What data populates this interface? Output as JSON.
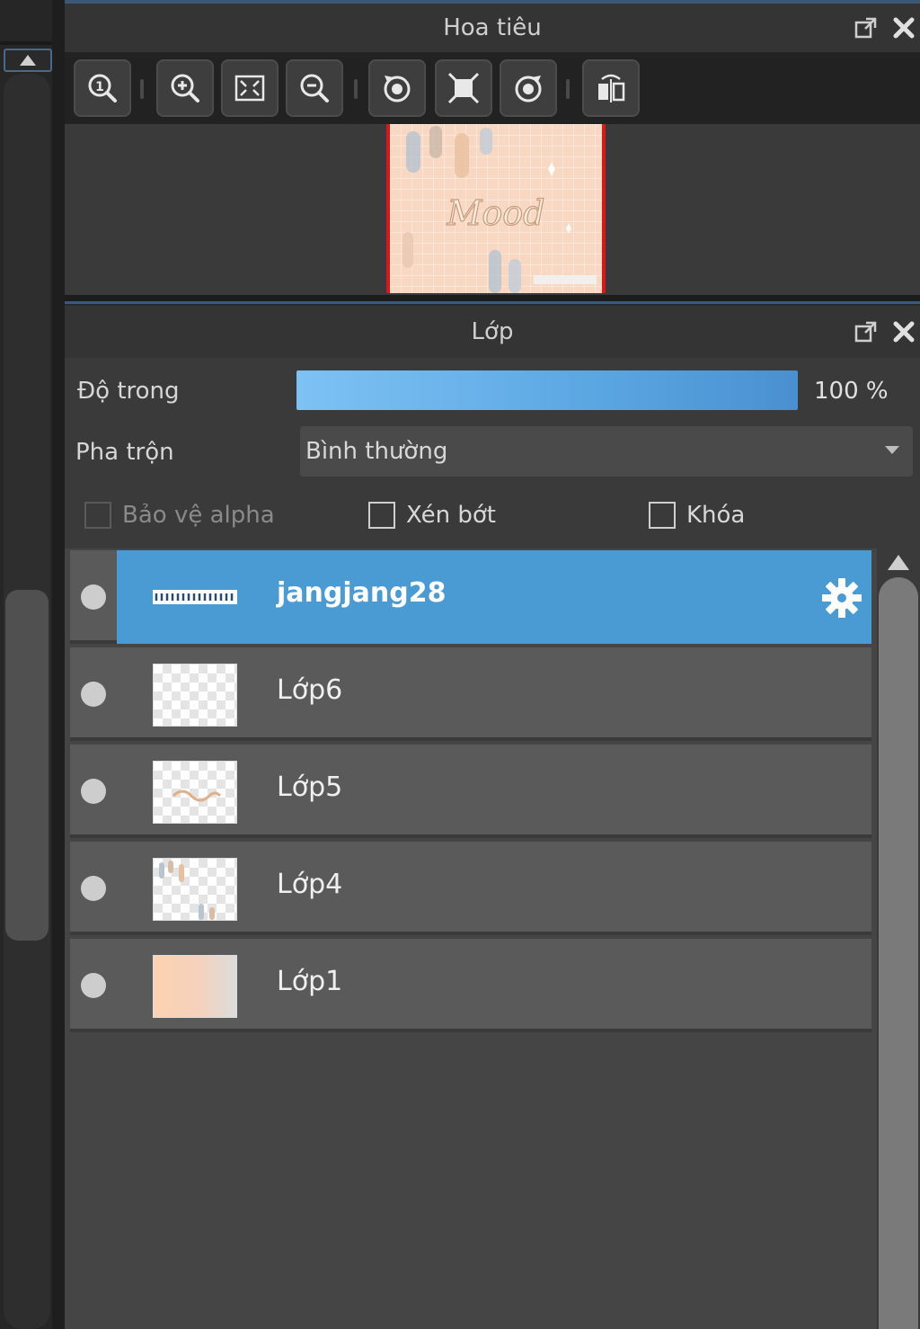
{
  "navigator": {
    "title": "Hoa tiêu",
    "toolbar": [
      {
        "icon": "zoom-actual-icon"
      },
      {
        "icon": "zoom-in-icon"
      },
      {
        "icon": "fit-screen-icon"
      },
      {
        "icon": "zoom-out-icon"
      },
      {
        "icon": "rotate-left-icon"
      },
      {
        "icon": "reset-view-icon"
      },
      {
        "icon": "rotate-right-icon"
      },
      {
        "icon": "flip-horizontal-icon"
      }
    ],
    "preview_text": "Mood"
  },
  "layers_panel": {
    "title": "Lớp",
    "opacity_label": "Độ trong",
    "opacity_value": "100 %",
    "opacity_fraction": 1.0,
    "blend_label": "Pha trộn",
    "blend_value": "Bình thường",
    "protect_alpha_label": "Bảo vệ alpha",
    "clipping_label": "Xén bớt",
    "lock_label": "Khóa",
    "layers": [
      {
        "name": "jangjang28",
        "selected": true
      },
      {
        "name": "Lớp6",
        "selected": false
      },
      {
        "name": "Lớp5",
        "selected": false
      },
      {
        "name": "Lớp4",
        "selected": false
      },
      {
        "name": "Lớp1",
        "selected": false
      }
    ]
  },
  "colors": {
    "accent": "#4a9ad4",
    "viewport_frame": "#d81818",
    "opacity_bar": "#5aa6e2"
  }
}
